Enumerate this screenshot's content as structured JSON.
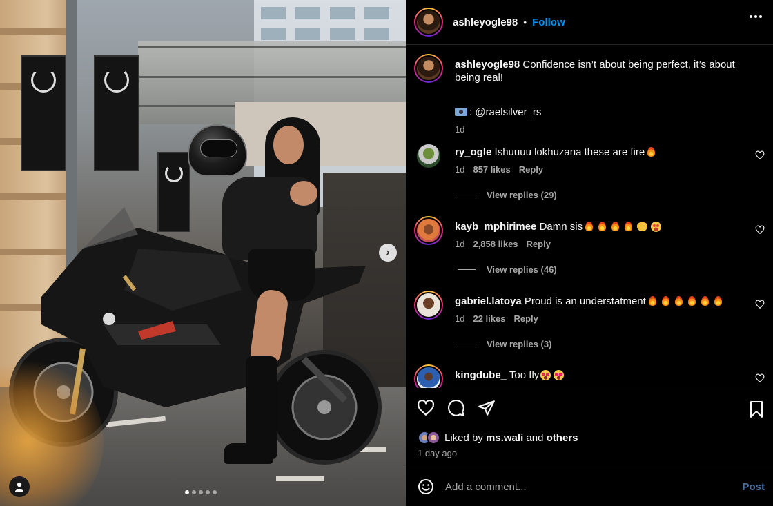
{
  "post": {
    "username": "ashleyogle98",
    "separator": "•",
    "follow_label": "Follow",
    "caption": "Confidence isn’t about being perfect, it’s about being real!",
    "credit_handle": ": @raelsilver_rs",
    "caption_time": "1d"
  },
  "comments": [
    {
      "username": "ry_ogle",
      "text": "Ishuuuu lokhuzana these are fire",
      "time": "1d",
      "likes": "857 likes",
      "reply_label": "Reply",
      "view_replies": "View replies (29)"
    },
    {
      "username": "kayb_mphirimee",
      "text": "Damn sis",
      "time": "1d",
      "likes": "2,858 likes",
      "reply_label": "Reply",
      "view_replies": "View replies (46)"
    },
    {
      "username": "gabriel.latoya",
      "text": "Proud is an understatment",
      "time": "1d",
      "likes": "22 likes",
      "reply_label": "Reply",
      "view_replies": "View replies (3)"
    },
    {
      "username": "kingdube_",
      "text": "Too fly"
    }
  ],
  "engagement": {
    "liked_by_prefix": "Liked by",
    "liked_by_user": "ms.wali",
    "liked_by_and": "and",
    "liked_by_others": "others",
    "post_time": "1 day ago"
  },
  "composer": {
    "placeholder": "Add a comment...",
    "post_label": "Post"
  },
  "carousel": {
    "slide_count": 5,
    "active_index": 0
  },
  "icons": {
    "more": "more-options-icon",
    "like": "heart-icon",
    "comment": "comment-icon",
    "share": "send-icon",
    "save": "bookmark-icon",
    "emoji": "emoji-icon",
    "next": "chevron-right-icon",
    "tags": "user-tag-icon"
  },
  "colors": {
    "link": "#0095f6",
    "background": "#000000",
    "secondary_text": "#a8a8a8",
    "post_button": "#4b6ea0"
  }
}
